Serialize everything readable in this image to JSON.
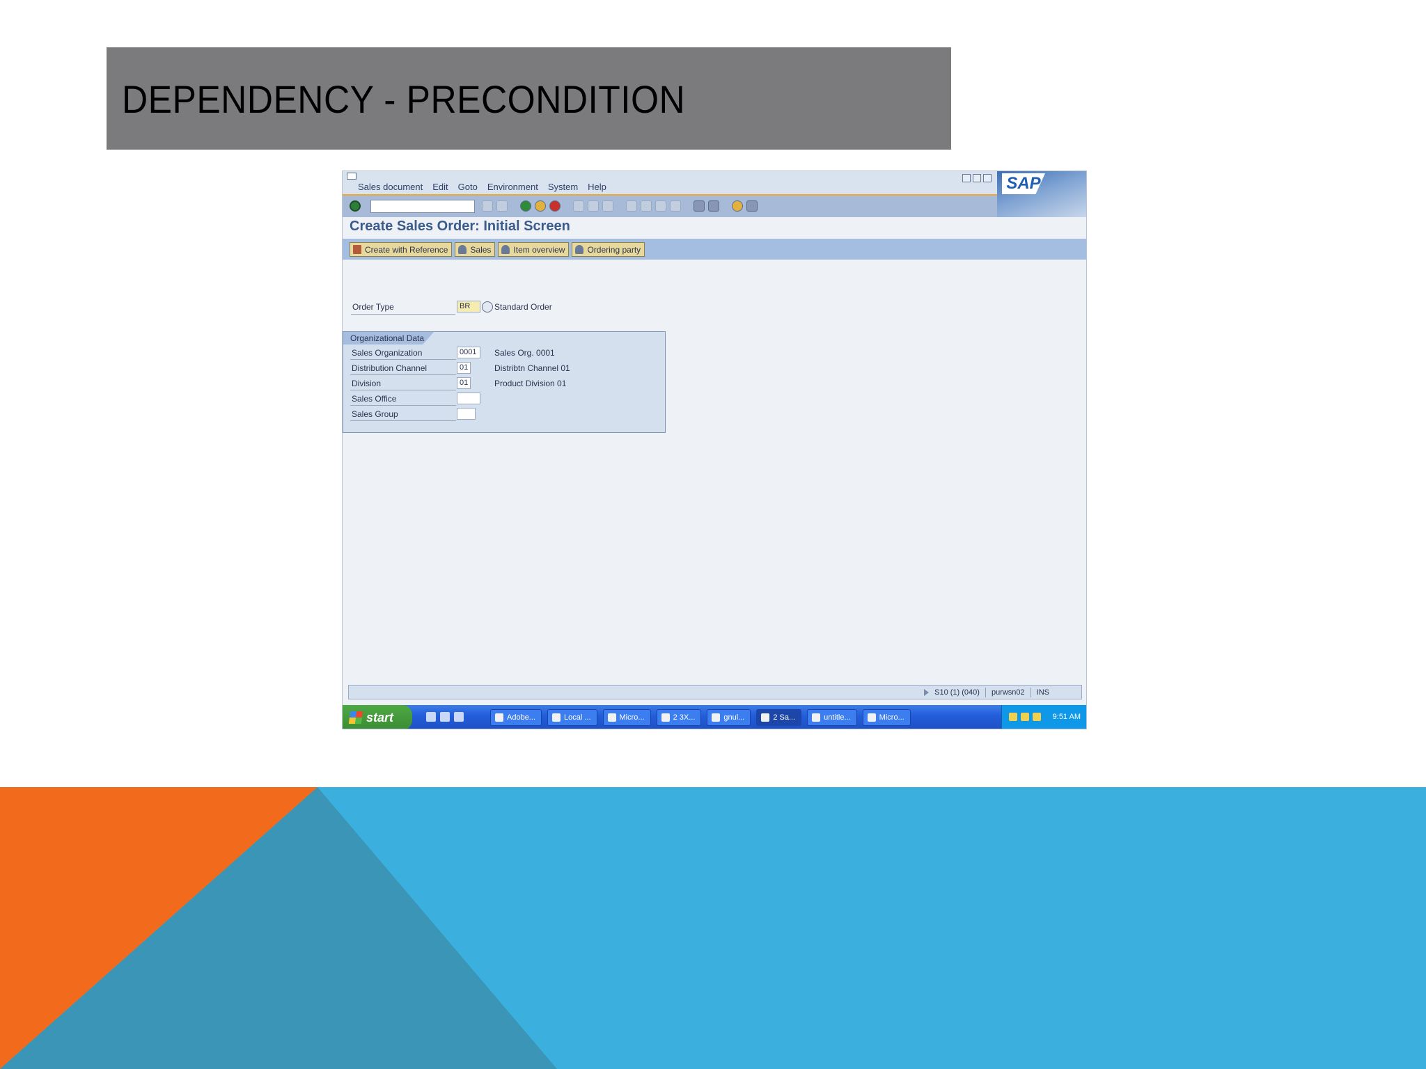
{
  "slide": {
    "title": "DEPENDENCY - PRECONDITION",
    "colors": {
      "title_bar": "#7b7b7e",
      "orange": "#f26a1c",
      "blue": "#3bb0df",
      "teal": "#3a95b6"
    }
  },
  "sap": {
    "menu": [
      "Sales document",
      "Edit",
      "Goto",
      "Environment",
      "System",
      "Help"
    ],
    "logo": "SAP",
    "toolbar_icons": [
      "enter-icon",
      "command-field",
      "save-icon",
      "back-icon",
      "exit-icon",
      "cancel-icon",
      "print-icon",
      "find-icon",
      "page-icons",
      "new-session-icon",
      "shortcut-icon",
      "help-icon",
      "layout-icon"
    ],
    "screen_title": "Create Sales Order: Initial Screen",
    "app_buttons": [
      {
        "label": "Create with Reference",
        "icon": "document-icon"
      },
      {
        "label": "Sales",
        "icon": "person-icon"
      },
      {
        "label": "Item overview",
        "icon": "person-icon"
      },
      {
        "label": "Ordering party",
        "icon": "person-icon"
      }
    ],
    "order_type": {
      "label": "Order Type",
      "value": "BR",
      "description": "Standard Order"
    },
    "org_data": {
      "title": "Organizational Data",
      "fields": [
        {
          "label": "Sales Organization",
          "value": "0001",
          "description": "Sales Org. 0001"
        },
        {
          "label": "Distribution Channel",
          "value": "01",
          "description": "Distribtn Channel 01"
        },
        {
          "label": "Division",
          "value": "01",
          "description": "Product Division 01"
        },
        {
          "label": "Sales Office",
          "value": "",
          "description": ""
        },
        {
          "label": "Sales Group",
          "value": "",
          "description": ""
        }
      ]
    },
    "status": {
      "system": "S10 (1) (040)",
      "user": "purwsn02",
      "mode": "INS"
    }
  },
  "taskbar": {
    "start": "start",
    "tasks": [
      "Adobe...",
      "Local ...",
      "Micro...",
      "2 3X...",
      "gnul...",
      "2 Sa...",
      "untitle...",
      "Micro..."
    ],
    "clock": "9:51 AM"
  }
}
